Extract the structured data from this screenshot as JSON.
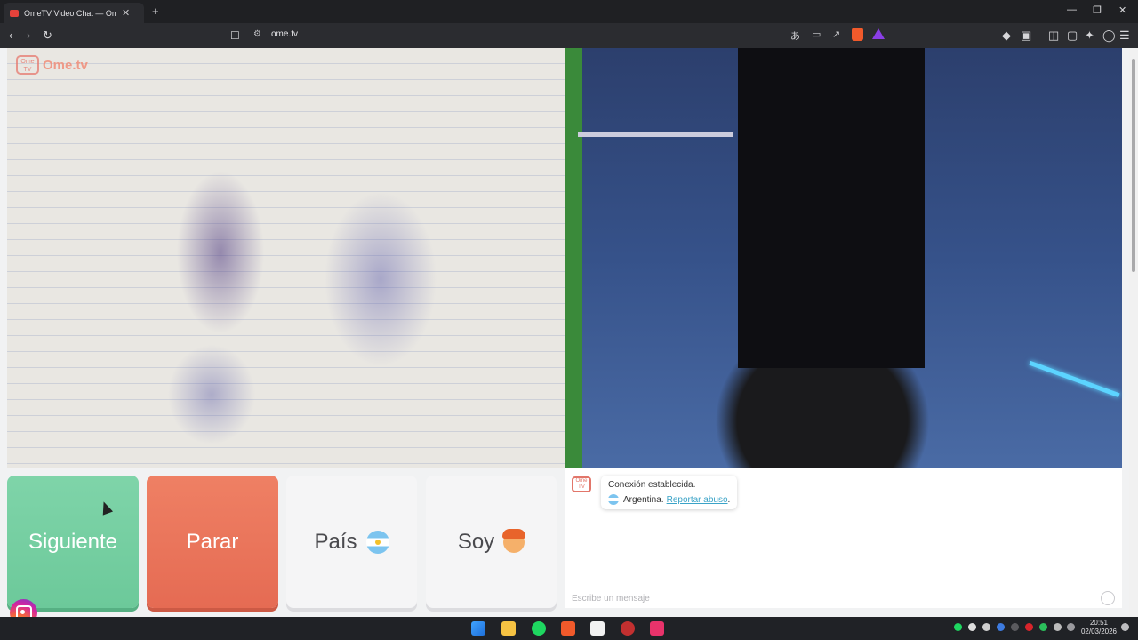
{
  "browser": {
    "tab_title": "OmeTV Video Chat — Omegle",
    "tab_close": "✕",
    "new_tab": "+",
    "window_controls": [
      "—",
      "❐",
      "✕"
    ],
    "url": "ome.tv",
    "icons": [
      "back-icon",
      "forward-icon",
      "reload-icon",
      "bookmark-icon",
      "site-info-icon",
      "translate-icon",
      "cast-icon",
      "share-icon",
      "brave-shields-icon",
      "brave-rewards-icon",
      "extensions-icon",
      "sidebar-icon",
      "wallet-icon",
      "leo-icon",
      "vpn-icon",
      "menu-icon"
    ]
  },
  "page": {
    "logo_badge": "Ome TV",
    "logo_text": "Ome.tv",
    "buttons": {
      "next": "Siguiente",
      "stop": "Parar",
      "country": "País",
      "gender": "Soy"
    },
    "chat": {
      "logo_badge": "Ome TV",
      "connection": "Conexión establecida.",
      "country": "Argentina.",
      "report": "Reportar abuso",
      "report_suffix": ".",
      "message_placeholder": "Escribe un mensaje"
    },
    "colors": {
      "next": "#7fd4a9",
      "stop": "#ef8064",
      "link": "#3aa3c7"
    }
  },
  "taskbar": {
    "clock_time": "20:51",
    "clock_date": "02/03/2026",
    "apps": [
      "windows-start-icon",
      "file-explorer-icon",
      "spotify-icon",
      "brave-icon",
      "capcut-icon",
      "app-icon",
      "tiktok-icon"
    ]
  }
}
